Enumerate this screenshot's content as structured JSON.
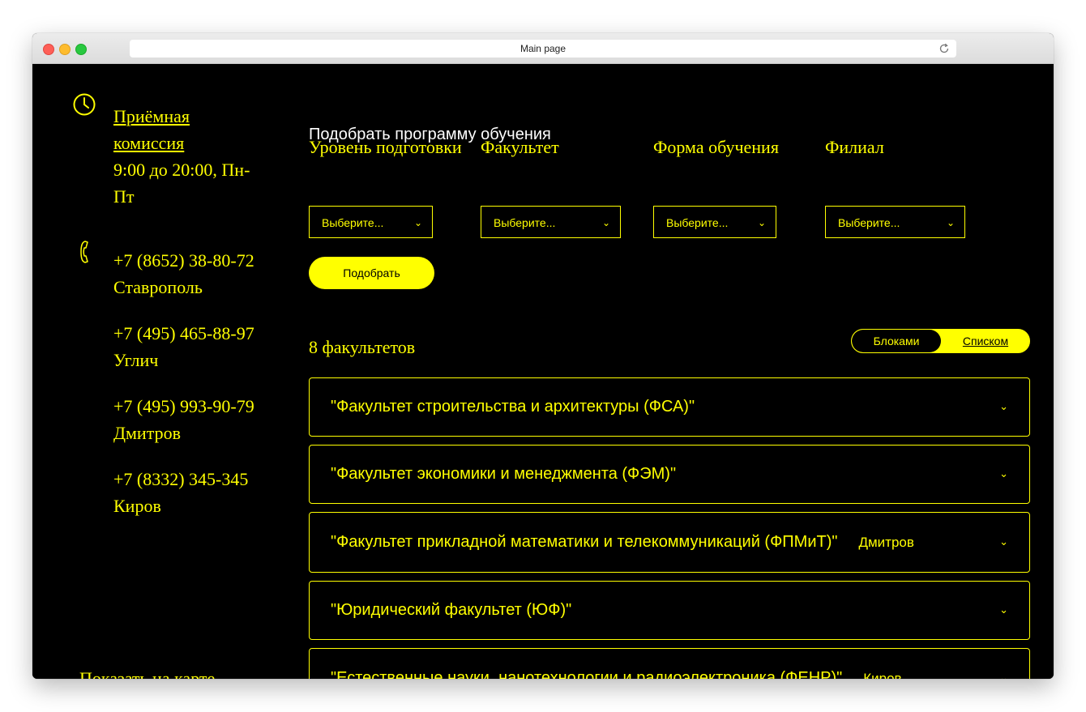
{
  "browser": {
    "title": "Main page"
  },
  "sidebar": {
    "admission_link": "Приёмная комиссия ",
    "hours": "9:00 до 20:00, Пн-Пт",
    "phones": [
      {
        "number": "+7 (8652) 38-80-72",
        "city": "Ставрополь"
      },
      {
        "number": "+7 (495) 465-88-97",
        "city": "Углич"
      },
      {
        "number": "+7 (495) 993-90-79",
        "city": "Дмитров"
      },
      {
        "number": "+7 (8332) 345-345",
        "city": "Киров"
      }
    ],
    "map_link": "Показать на карте"
  },
  "filter": {
    "title": "Подобрать программу обучения",
    "fields": [
      {
        "label": "Уровень подготовки",
        "value": "Выберите..."
      },
      {
        "label": "Факультет",
        "value": "Выберите..."
      },
      {
        "label": "Форма обучения",
        "value": "Выберите..."
      },
      {
        "label": "Филиал",
        "value": "Выберите..."
      }
    ],
    "submit_label": "Подобрать"
  },
  "results": {
    "count_label": "8 факультетов",
    "view_toggle": {
      "blocks": "Блоками",
      "list": "Списком"
    },
    "faculties": [
      {
        "name": "\"Факультет строительства и архитектуры (ФСА)\"",
        "branch": ""
      },
      {
        "name": "\"Факультет экономики и менеджмента (ФЭМ)\"",
        "branch": ""
      },
      {
        "name": "\"Факультет прикладной математики и телекоммуникаций (ФПМиТ)\"",
        "branch": "Дмитров"
      },
      {
        "name": "\"Юридический факультет (ЮФ)\"",
        "branch": ""
      },
      {
        "name": "\"Естественные науки, нанотехнологии и радиоэлектроника (ФЕНР)\"",
        "branch": "Киров"
      }
    ]
  },
  "colors": {
    "accent": "#ffff00",
    "background": "#000000"
  }
}
